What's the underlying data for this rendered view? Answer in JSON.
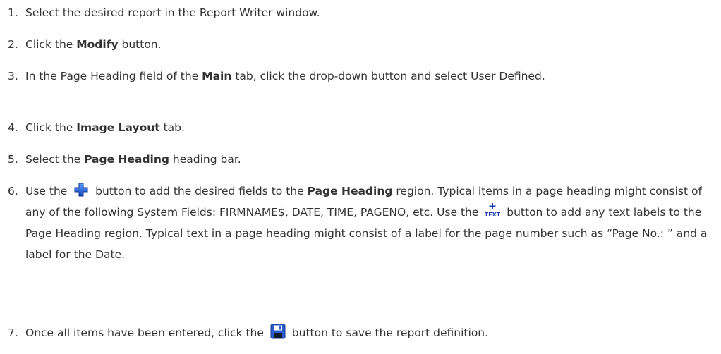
{
  "steps": [
    {
      "number": "1.",
      "text": "Select the desired report in the Report Writer window."
    },
    {
      "number": "2.",
      "pre": "Click the ",
      "bold": "Modify",
      "post": " button."
    },
    {
      "number": "3.",
      "pre": "In the Page Heading field of the ",
      "bold": "Main",
      "post": " tab, click the drop-down button and select User Defined."
    },
    {
      "number": "4.",
      "pre": "Click the ",
      "bold": "Image Layout",
      "post": " tab."
    },
    {
      "number": "5.",
      "pre": "Select the ",
      "bold": "Page Heading",
      "post": " heading bar."
    },
    {
      "number": "6.",
      "pre": "Use the ",
      "icon1": "add-field-icon",
      "mid1": " button to add the desired fields to the ",
      "bold": "Page Heading",
      "mid2": " region. Typical items in a page heading might consist of any of the following System Fields: FIRMNAME$, DATE, TIME, PAGENO, etc. Use the ",
      "icon2": "add-text-icon",
      "icon2_text": "TEXT",
      "post": " button to add any text labels to the Page Heading region. Typical text in a page heading might consist of a label for the page number such as “Page No.: ” and a label for the Date."
    },
    {
      "number": "7.",
      "pre": "Once all items have been entered, click the ",
      "icon": "save-disk-icon",
      "post": " button to save the report definition."
    }
  ],
  "colors": {
    "text": "#333333",
    "add_icon_blue": "#1a5fd0",
    "text_icon_blue": "#1c3fb0",
    "save_icon_blue": "#2a5ccf"
  }
}
